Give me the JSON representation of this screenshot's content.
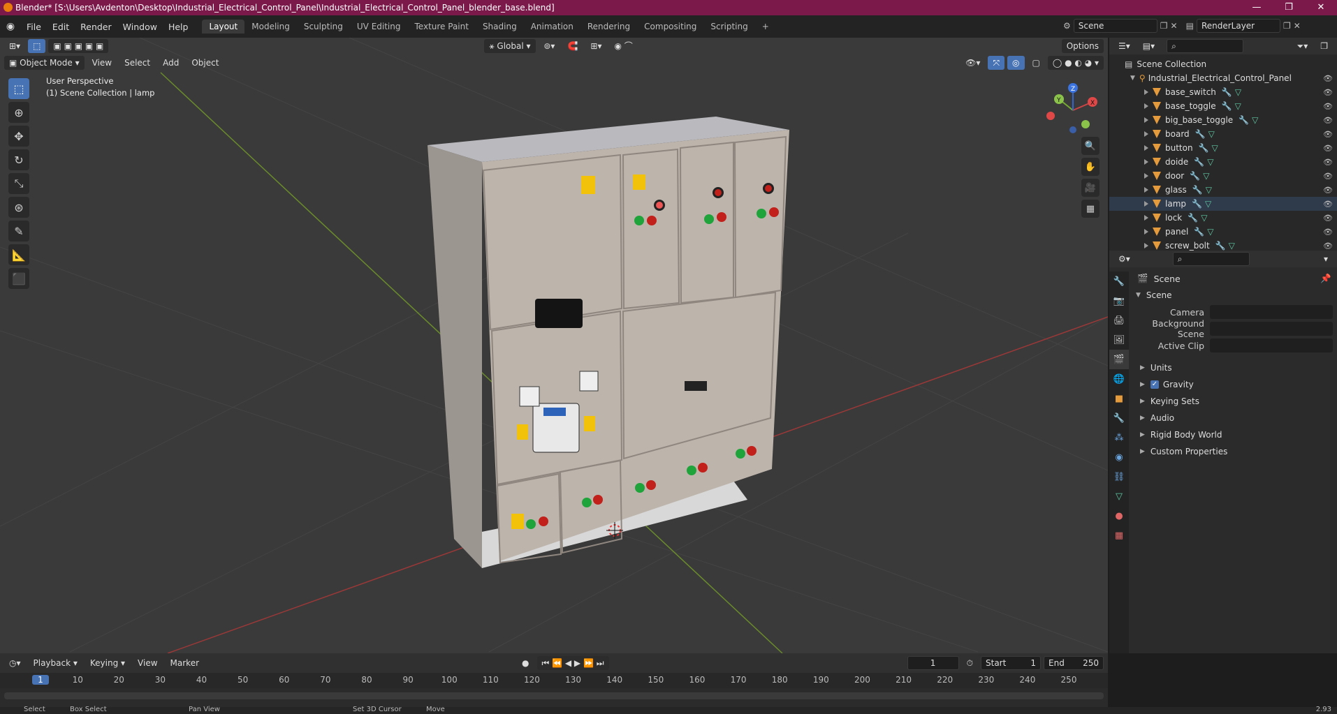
{
  "window": {
    "title": "Blender* [S:\\Users\\Avdenton\\Desktop\\Industrial_Electrical_Control_Panel\\Industrial_Electrical_Control_Panel_blender_base.blend]",
    "minimize": "—",
    "maximize": "❐",
    "close": "✕"
  },
  "menu": {
    "items": [
      "File",
      "Edit",
      "Render",
      "Window",
      "Help"
    ]
  },
  "workspaces": [
    "Layout",
    "Modeling",
    "Sculpting",
    "UV Editing",
    "Texture Paint",
    "Shading",
    "Animation",
    "Rendering",
    "Compositing",
    "Scripting"
  ],
  "add_workspace": "+",
  "scene_field": "Scene",
  "renderlayer_field": "RenderLayer",
  "viewport": {
    "transform_orientation": "Global",
    "options_label": "Options",
    "mode_label": "Object Mode",
    "header_menus": [
      "View",
      "Select",
      "Add",
      "Object"
    ],
    "perspective_label": "User Perspective",
    "collection_label": "(1) Scene Collection | lamp",
    "gizmo_axes": {
      "x": "X",
      "y": "Y",
      "z": "Z"
    }
  },
  "outliner": {
    "root": "Scene Collection",
    "collection": "Industrial_Electrical_Control_Panel",
    "objects": [
      "base_switch",
      "base_toggle",
      "big_base_toggle",
      "board",
      "button",
      "doide",
      "door",
      "glass",
      "lamp",
      "lock",
      "panel",
      "screw_bolt"
    ],
    "selected": "lamp"
  },
  "properties": {
    "context_title": "Scene",
    "panel_title": "Scene",
    "fields": [
      {
        "label": "Camera"
      },
      {
        "label": "Background Scene"
      },
      {
        "label": "Active Clip"
      }
    ],
    "sections": [
      "Units",
      "Gravity",
      "Keying Sets",
      "Audio",
      "Rigid Body World",
      "Custom Properties"
    ],
    "gravity_checked": true
  },
  "timeline": {
    "menus": [
      "Playback",
      "Keying",
      "View",
      "Marker"
    ],
    "current_frame": "1",
    "start_label": "Start",
    "start_value": "1",
    "end_label": "End",
    "end_value": "250",
    "ruler_ticks": [
      "1",
      "10",
      "20",
      "30",
      "40",
      "50",
      "60",
      "70",
      "80",
      "90",
      "100",
      "110",
      "120",
      "130",
      "140",
      "150",
      "160",
      "170",
      "180",
      "190",
      "200",
      "210",
      "220",
      "230",
      "240",
      "250"
    ]
  },
  "statusbar": {
    "items": [
      "Select",
      "Box Select",
      "Pan View",
      "Set 3D Cursor",
      "Move"
    ],
    "version": "2.93"
  }
}
